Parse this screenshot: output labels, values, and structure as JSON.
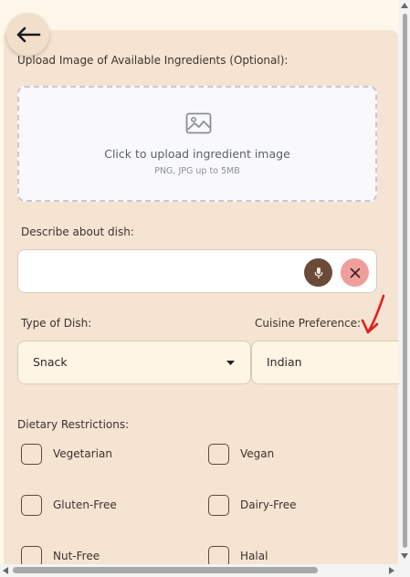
{
  "upload": {
    "label": "Upload Image of Available Ingredients (Optional):",
    "main_text": "Click to upload ingredient image",
    "sub_text": "PNG, JPG up to 5MB",
    "icon": "image-icon"
  },
  "describe": {
    "label": "Describe about dish:",
    "value": "",
    "placeholder": "",
    "mic_icon": "mic-icon",
    "clear_icon": "close-icon"
  },
  "dish_type": {
    "label": "Type of Dish:",
    "selected": "Snack"
  },
  "cuisine": {
    "label": "Cuisine Preference:",
    "selected": "Indian"
  },
  "dietary": {
    "label": "Dietary Restrictions:",
    "options": [
      "Vegetarian",
      "Vegan",
      "Gluten-Free",
      "Dairy-Free",
      "Nut-Free",
      "Halal"
    ]
  },
  "colors": {
    "background": "#fff7e9",
    "panel": "#f5e4d2",
    "mic_button": "#6b4b37",
    "clear_button": "#ef9f9b",
    "annotation": "#e02020"
  }
}
